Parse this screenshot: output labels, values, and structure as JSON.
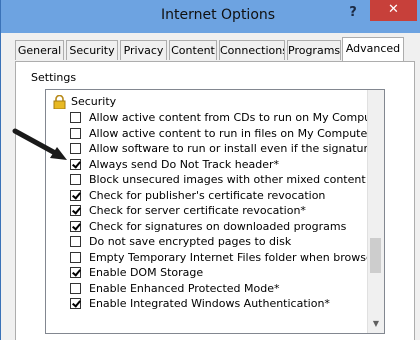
{
  "window": {
    "title": "Internet Options",
    "help": "?",
    "close": "✕"
  },
  "tabs": [
    {
      "label": "General",
      "active": false
    },
    {
      "label": "Security",
      "active": false
    },
    {
      "label": "Privacy",
      "active": false
    },
    {
      "label": "Content",
      "active": false
    },
    {
      "label": "Connections",
      "active": false
    },
    {
      "label": "Programs",
      "active": false
    },
    {
      "label": "Advanced",
      "active": true
    }
  ],
  "settings": {
    "label": "Settings",
    "header": "Security",
    "items": [
      {
        "label": "Allow active content from CDs to run on My Computer*",
        "checked": false
      },
      {
        "label": "Allow active content to run in files on My Computer*",
        "checked": false
      },
      {
        "label": "Allow software to run or install even if the signature is inva",
        "checked": false
      },
      {
        "label": "Always send Do Not Track header*",
        "checked": true
      },
      {
        "label": "Block unsecured images with other mixed content",
        "checked": false
      },
      {
        "label": "Check for publisher's certificate revocation",
        "checked": true
      },
      {
        "label": "Check for server certificate revocation*",
        "checked": true
      },
      {
        "label": "Check for signatures on downloaded programs",
        "checked": true
      },
      {
        "label": "Do not save encrypted pages to disk",
        "checked": false
      },
      {
        "label": "Empty Temporary Internet Files folder when browser is clo",
        "checked": false
      },
      {
        "label": "Enable DOM Storage",
        "checked": true
      },
      {
        "label": "Enable Enhanced Protected Mode*",
        "checked": false
      },
      {
        "label": "Enable Integrated Windows Authentication*",
        "checked": true
      }
    ]
  },
  "icons": {
    "lock": "lock-icon",
    "arrow": "arrow-annotation-icon",
    "scroll_down": "scroll-down-arrow-icon"
  },
  "colors": {
    "titlebar": "#6da3e1",
    "close": "#c7403a",
    "arrow": "#1a1a1a"
  }
}
